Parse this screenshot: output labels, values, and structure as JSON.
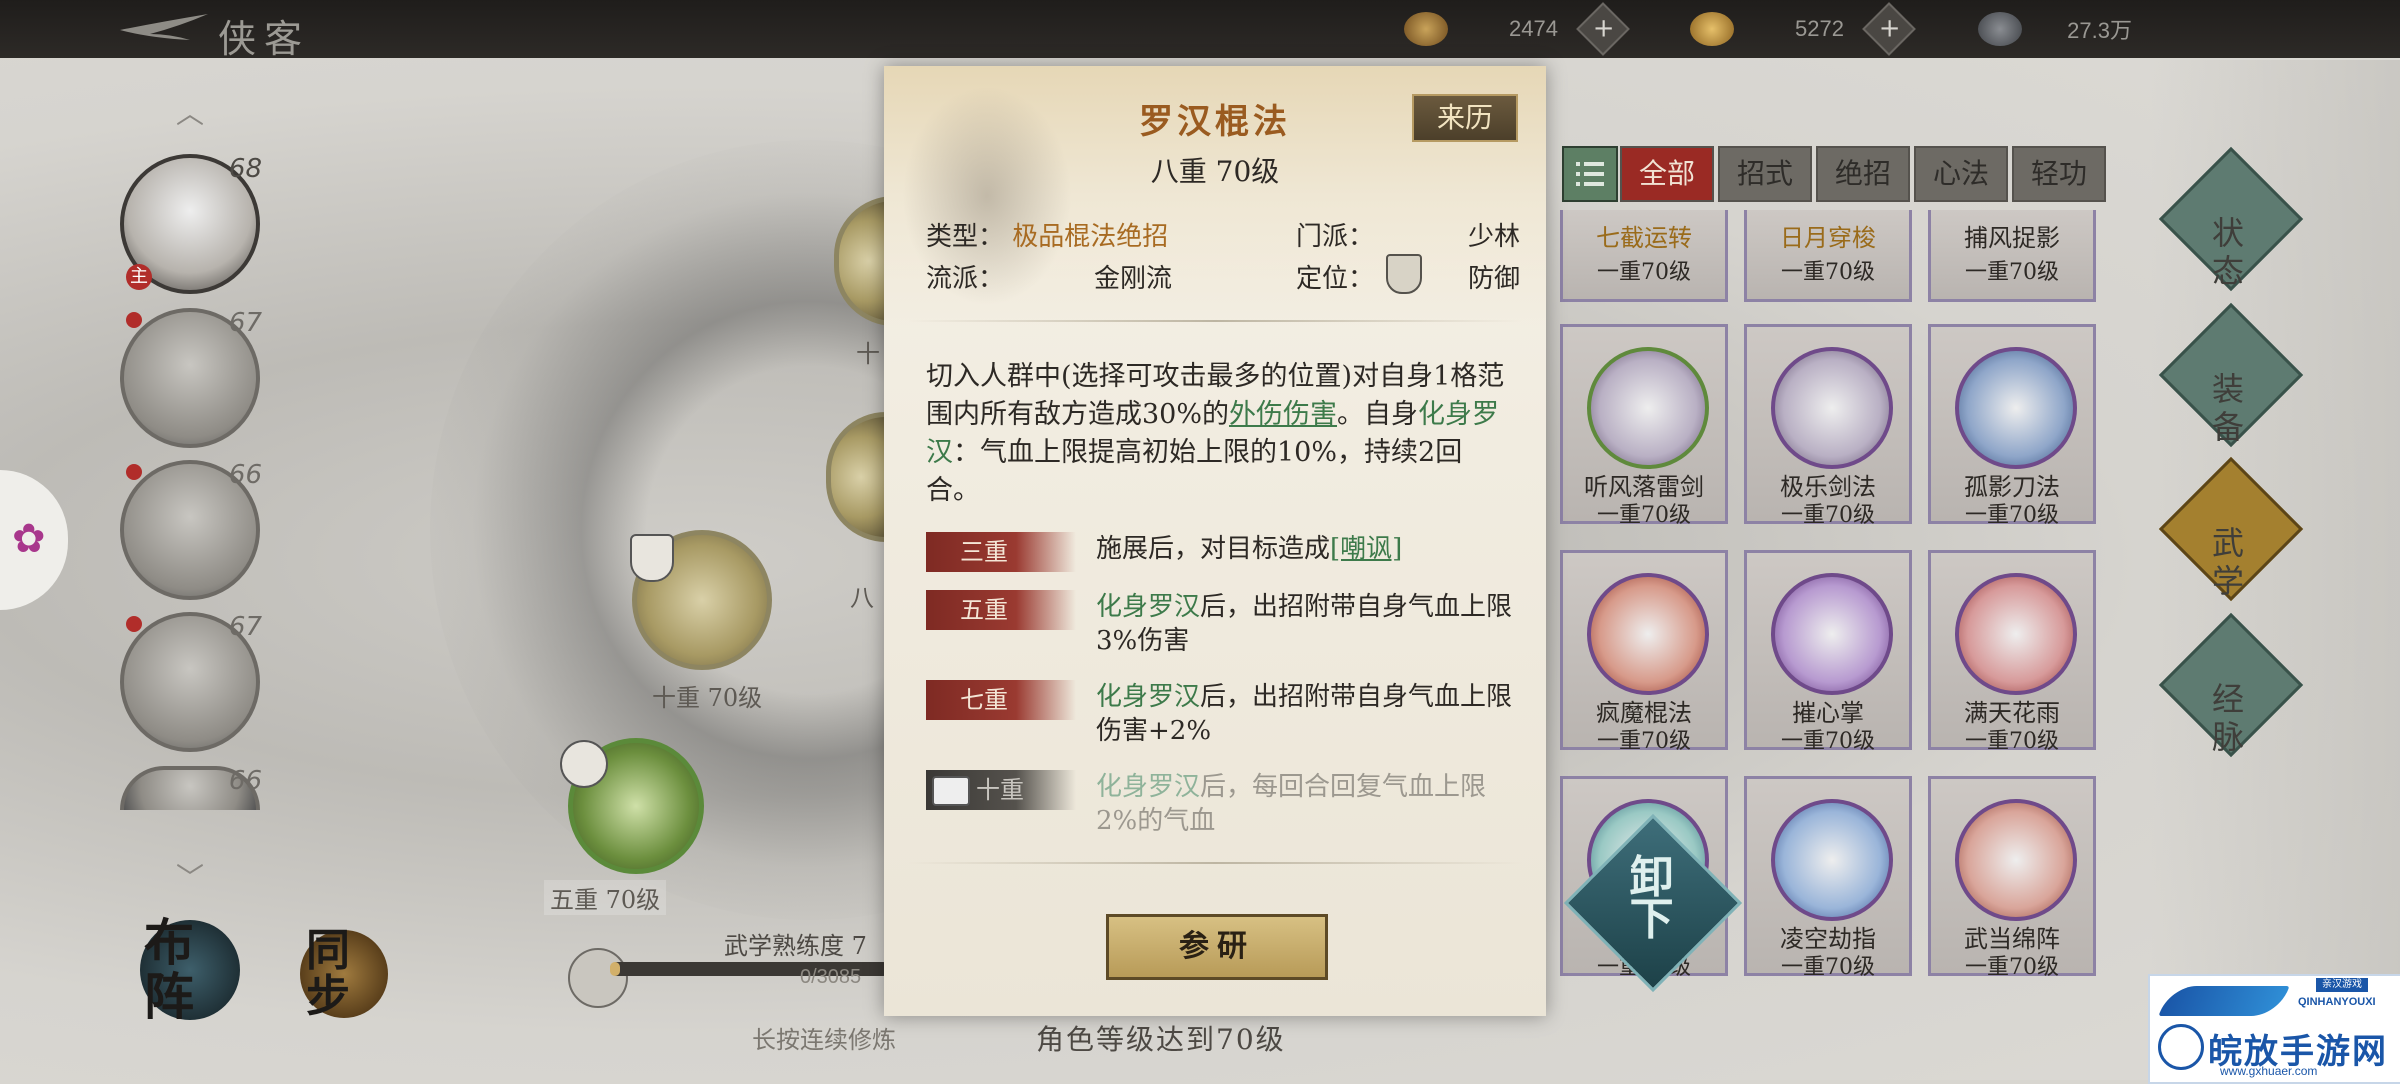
{
  "header": {
    "title": "侠客",
    "resources": [
      {
        "icon": "leaf-currency-icon",
        "value": "2474"
      },
      {
        "icon": "gold-ingot-icon",
        "value": "5272"
      },
      {
        "icon": "coin-icon",
        "value": "27.3万"
      }
    ]
  },
  "roster": {
    "characters": [
      {
        "level": "68",
        "badge": "主"
      },
      {
        "level": "67"
      },
      {
        "level": "66"
      },
      {
        "level": "67"
      },
      {
        "level": "66"
      }
    ],
    "buttons": {
      "formation": "布阵",
      "sync": "同步"
    }
  },
  "tree": {
    "node_labels": [
      "十重 70级",
      "五重 70级",
      "十",
      "八"
    ],
    "mastery_label": "武学熟练度 7",
    "mastery_value": "0/3085",
    "hint_hold": "长按连续修炼",
    "requirement": "角色等级达到70级"
  },
  "modal": {
    "name": "罗汉棍法",
    "level": "八重 70级",
    "origin_button": "来历",
    "type_key": "类型：",
    "type_value": "极品棍法绝招",
    "sect_key": "门派：",
    "sect_value": "少林",
    "school_key": "流派：",
    "school_value": "金刚流",
    "role_key": "定位：",
    "role_value": "防御",
    "desc_1": "切入人群中(选择可攻击最多的位置)对自身1格范围内所有敌方造成30%的",
    "desc_link_1": "外伤伤害",
    "desc_2": "。自身",
    "desc_buff": "化身罗汉",
    "desc_3": "：气血上限提高初始上限的10%，持续2回合。",
    "tiers": [
      {
        "badge": "三重",
        "pre": "施展后，对目标造成",
        "link": "[嘲讽]",
        "post": ""
      },
      {
        "badge": "五重",
        "pre": "",
        "link": "化身罗汉",
        "post": "后，出招附带自身气血上限3%伤害"
      },
      {
        "badge": "七重",
        "pre": "",
        "link": "化身罗汉",
        "post": "后，出招附带自身气血上限伤害+2%"
      },
      {
        "badge": "十重",
        "pre": "",
        "link": "化身罗汉",
        "post": "后，每回合回复气血上限2%的气血"
      }
    ],
    "study_button": "参研"
  },
  "filters": [
    "全部",
    "招式",
    "绝招",
    "心法",
    "轻功"
  ],
  "skills": [
    {
      "name": "七截运转",
      "level": "一重70级"
    },
    {
      "name": "日月穿梭",
      "level": "一重70级"
    },
    {
      "name": "捕风捉影",
      "level": "一重70级"
    },
    {
      "name": "听风落雷剑",
      "level": "一重70级"
    },
    {
      "name": "极乐剑法",
      "level": "一重70级"
    },
    {
      "name": "孤影刀法",
      "level": "一重70级"
    },
    {
      "name": "疯魔棍法",
      "level": "一重70级"
    },
    {
      "name": "摧心掌",
      "level": "一重70级"
    },
    {
      "name": "满天花雨",
      "level": "一重70级"
    },
    {
      "name": "",
      "level": "一重70级"
    },
    {
      "name": "凌空劫指",
      "level": "一重70级"
    },
    {
      "name": "武当绵阵",
      "level": "一重70级"
    }
  ],
  "unload_button": "卸下",
  "side_nav": [
    "状态",
    "装备",
    "武学",
    "经脉"
  ],
  "watermark": {
    "cn": "皖放手游网",
    "en": "QINHANYOUXI",
    "url": "www.gxhuaer.com",
    "badge": "亲汉游戏"
  }
}
